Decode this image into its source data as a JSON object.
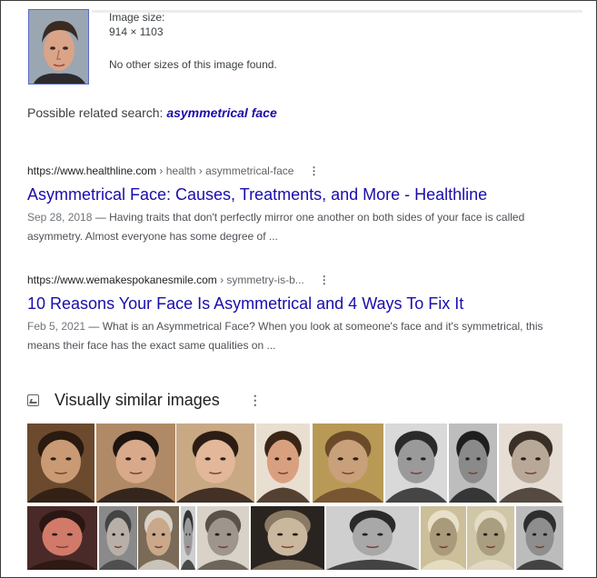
{
  "image_info": {
    "size_label": "Image size:",
    "dimensions": "914 × 1103",
    "no_other_sizes": "No other sizes of this image found."
  },
  "related_search": {
    "prefix": "Possible related search:",
    "query": "asymmetrical face"
  },
  "results": [
    {
      "domain": "https://www.healthline.com",
      "path": " › health › asymmetrical-face",
      "title": "Asymmetrical Face: Causes, Treatments, and More - Healthline",
      "date": "Sep 28, 2018",
      "snippet": " — Having traits that don't perfectly mirror one another on both sides of your face is called asymmetry. Almost everyone has some degree of ..."
    },
    {
      "domain": "https://www.wemakespokanesmile.com",
      "path": " › symmetry-is-b...",
      "title": "10 Reasons Your Face Is Asymmetrical and 4 Ways To Fix It",
      "date": "Feb 5, 2021",
      "snippet": " — What is an Asymmetrical Face? When you look at someone's face and it's symmetrical, this means their face has the exact same qualities on ..."
    }
  ],
  "visually_similar": {
    "heading": "Visually similar images",
    "menu": "⋮",
    "images": [
      {
        "name": "painting-bearded-man",
        "bg": "#6b4a2e",
        "face": "#c99a73",
        "hair": "#2a1a10"
      },
      {
        "name": "painting-woman-dark-hair",
        "bg": "#b08a66",
        "face": "#d8a98a",
        "hair": "#1e1410"
      },
      {
        "name": "painting-young-woman",
        "bg": "#c9a884",
        "face": "#e2b79a",
        "hair": "#2c1c14"
      },
      {
        "name": "drawing-injured-face",
        "bg": "#e9dfd0",
        "face": "#d9a07f",
        "hair": "#3a2616"
      },
      {
        "name": "mosaic-christ",
        "bg": "#b89a56",
        "face": "#c8a07a",
        "hair": "#6b4a2a"
      },
      {
        "name": "photo-lincoln-1",
        "bg": "#d9d9d9",
        "face": "#9a9a9a",
        "hair": "#2a2a2a"
      },
      {
        "name": "photo-lincoln-2",
        "bg": "#bdbdbd",
        "face": "#8a8a8a",
        "hair": "#1e1e1e"
      },
      {
        "name": "photo-lincoln-3",
        "bg": "#e6ded4",
        "face": "#b8a898",
        "hair": "#3a3028"
      },
      {
        "name": "painting-reddish-face",
        "bg": "#4a2a28",
        "face": "#d27a6a",
        "hair": "#2a1612"
      },
      {
        "name": "photo-churchill",
        "bg": "#8a8a8a",
        "face": "#b8b0a8",
        "hair": "#444444"
      },
      {
        "name": "painting-officer",
        "bg": "#7a6a58",
        "face": "#caa88a",
        "hair": "#d8d2c8"
      },
      {
        "name": "photo-profile-partial",
        "bg": "#cfcfcf",
        "face": "#9a9a9a",
        "hair": "#333333"
      },
      {
        "name": "photo-bald-man-profile",
        "bg": "#d8d2c8",
        "face": "#9e968c",
        "hair": "#5a5248"
      },
      {
        "name": "death-mask",
        "bg": "#2a2420",
        "face": "#c9b89e",
        "hair": "#8a7a64"
      },
      {
        "name": "photo-young-man-portrait",
        "bg": "#cfcfcf",
        "face": "#a8a8a8",
        "hair": "#2a2a2a"
      },
      {
        "name": "photo-old-man-1",
        "bg": "#ccbf9a",
        "face": "#a89a7a",
        "hair": "#e8e0c8"
      },
      {
        "name": "photo-old-man-2",
        "bg": "#d0c6a8",
        "face": "#aa9e80",
        "hair": "#e4dcc6"
      },
      {
        "name": "photo-churchill-2",
        "bg": "#bcbcbc",
        "face": "#8e8e8e",
        "hair": "#2e2e2e"
      }
    ]
  },
  "icons": {
    "result_menu": "⋮",
    "visual_icon": "image-icon"
  }
}
